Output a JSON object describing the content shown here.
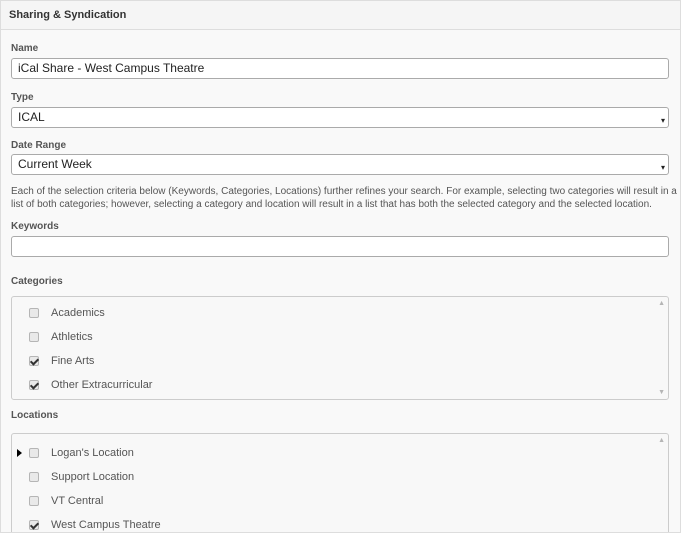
{
  "panel": {
    "title": "Sharing & Syndication"
  },
  "name_field": {
    "label": "Name",
    "value": "iCal Share - West Campus Theatre"
  },
  "type_field": {
    "label": "Type",
    "selected": "ICAL"
  },
  "date_range_field": {
    "label": "Date Range",
    "selected": "Current Week"
  },
  "help_text": "Each of the selection criteria below (Keywords, Categories, Locations) further refines your search. For example, selecting two categories will result in a list of both categories; however, selecting a category and location will result in a list that has both the selected category and the selected location.",
  "keywords_field": {
    "label": "Keywords",
    "value": ""
  },
  "categories": {
    "label": "Categories",
    "items": [
      {
        "label": "Academics",
        "checked": false
      },
      {
        "label": "Athletics",
        "checked": false
      },
      {
        "label": "Fine Arts",
        "checked": true
      },
      {
        "label": "Other Extracurricular",
        "checked": true
      }
    ]
  },
  "locations": {
    "label": "Locations",
    "items": [
      {
        "label": "Logan's Location",
        "checked": false,
        "expandable": true
      },
      {
        "label": "Support Location",
        "checked": false,
        "expandable": false
      },
      {
        "label": "VT Central",
        "checked": false,
        "expandable": false
      },
      {
        "label": "West Campus Theatre",
        "checked": true,
        "expandable": false
      }
    ]
  },
  "icons": {
    "select_caret": "▾",
    "scroll_up": "▲",
    "scroll_down": "▼"
  }
}
